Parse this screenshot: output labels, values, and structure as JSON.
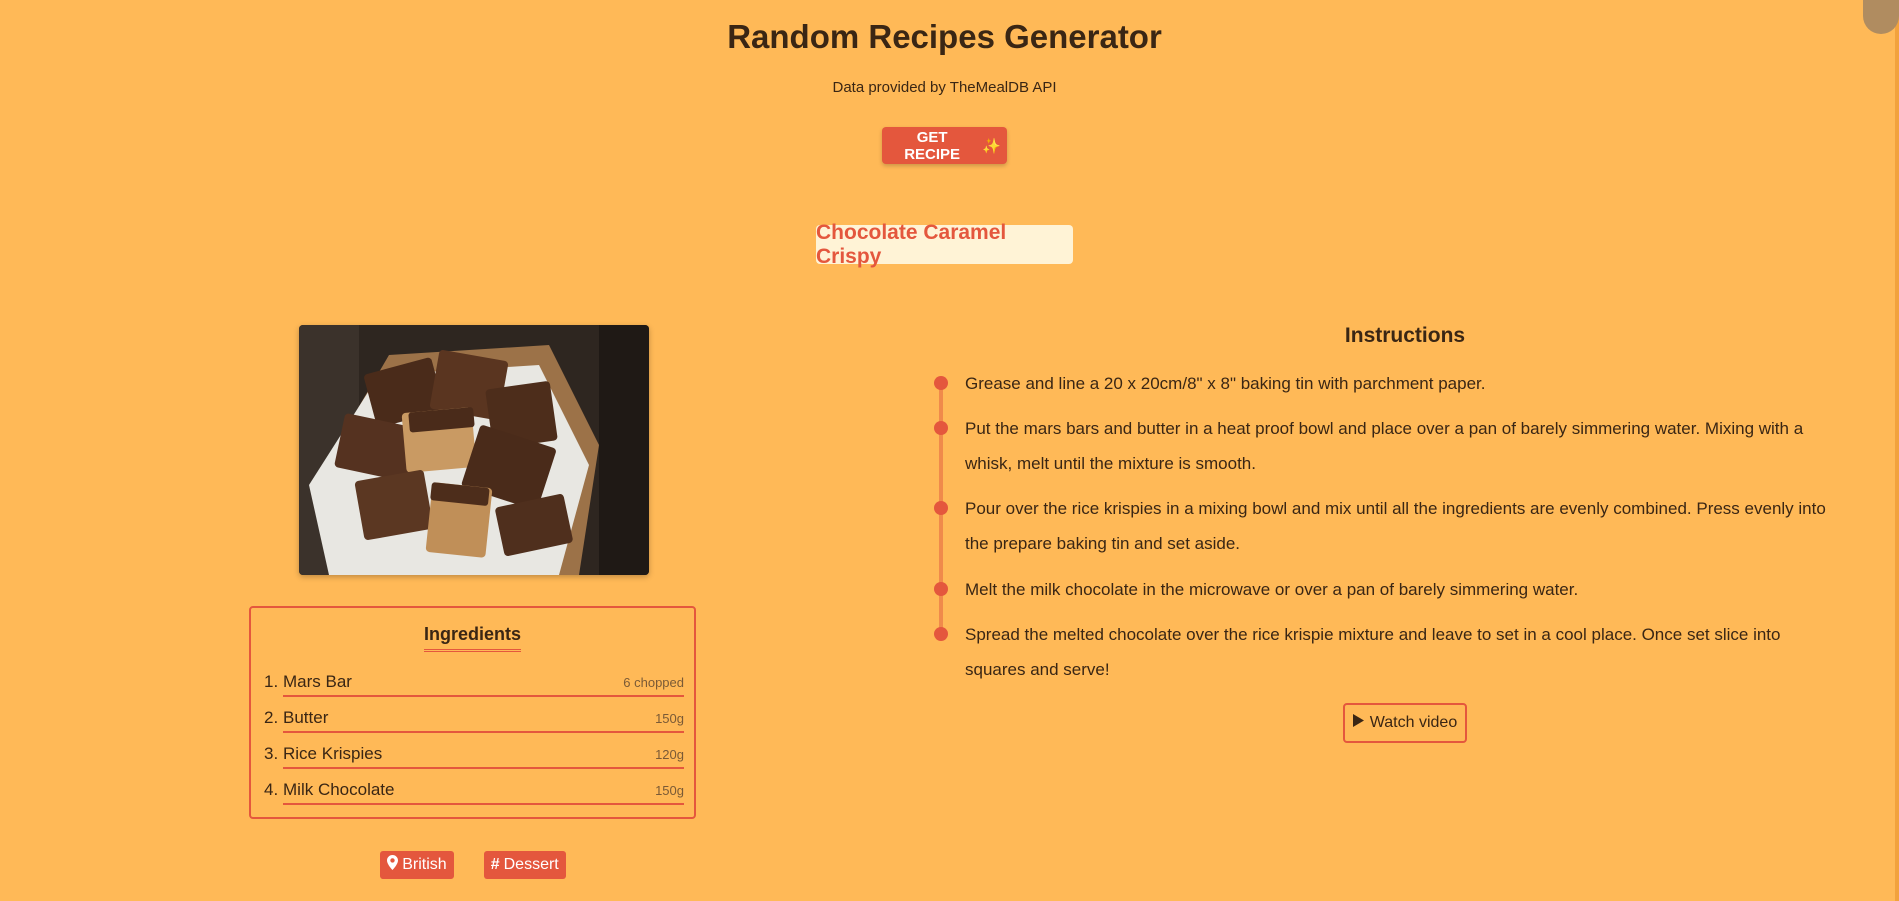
{
  "header": {
    "title": "Random Recipes Generator",
    "subtitle": "Data provided by TheMealDB API",
    "button_label": "GET RECIPE",
    "button_emoji": "✨"
  },
  "meal": {
    "name": "Chocolate Caramel Crispy"
  },
  "ingredients": {
    "title": "Ingredients",
    "items": [
      {
        "num": "1.",
        "name": "Mars Bar",
        "measure": "6 chopped"
      },
      {
        "num": "2.",
        "name": "Butter",
        "measure": "150g"
      },
      {
        "num": "3.",
        "name": "Rice Krispies",
        "measure": "120g"
      },
      {
        "num": "4.",
        "name": "Milk Chocolate",
        "measure": "150g"
      }
    ]
  },
  "tags": {
    "area": "British",
    "category": "Dessert"
  },
  "instructions": {
    "title": "Instructions",
    "steps": [
      "Grease and line a 20 x 20cm/8\" x 8\" baking tin with parchment paper.",
      "Put the mars bars and butter in a heat proof bowl and place over a pan of barely simmering water. Mixing with a whisk, melt until the mixture is smooth.",
      "Pour over the rice krispies in a mixing bowl and mix until all the ingredients are evenly combined. Press evenly into the prepare baking tin and set aside.",
      "Melt the milk chocolate in the microwave or over a pan of barely simmering water.",
      "Spread the melted chocolate over the rice krispie mixture and leave to set in a cool place. Once set slice into squares and serve!"
    ],
    "video_label": "Watch video"
  },
  "colors": {
    "background": "#FFB957",
    "accent": "#E4573D",
    "title_bg": "#FFF3D6"
  }
}
